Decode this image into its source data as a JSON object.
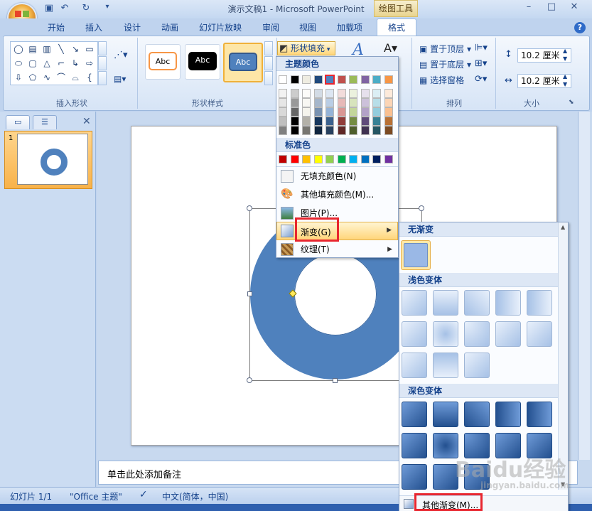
{
  "window": {
    "title": "演示文稿1 - Microsoft PowerPoint",
    "contextual_tab_group": "绘图工具"
  },
  "tabs": [
    "开始",
    "插入",
    "设计",
    "动画",
    "幻灯片放映",
    "审阅",
    "视图",
    "加载项",
    "格式"
  ],
  "ribbon": {
    "groups": {
      "insert_shapes": "插入形状",
      "shape_styles": "形状样式",
      "arrange": "排列",
      "size": "大小"
    },
    "style_sample_text": "Abc",
    "shape_fill_label": "形状填充",
    "arrange_items": [
      "置于顶层",
      "置于底层",
      "选择窗格"
    ],
    "height_value": "10.2 厘米",
    "width_value": "10.2 厘米"
  },
  "slide_panel": {
    "slide_number": "1"
  },
  "notes_placeholder": "单击此处添加备注",
  "status_bar": {
    "slide": "幻灯片 1/1",
    "theme": "\"Office 主题\"",
    "language": "中文(简体，中国)"
  },
  "fill_menu": {
    "theme_colors_header": "主题颜色",
    "standard_colors_header": "标准色",
    "theme_colors_top": [
      "#ffffff",
      "#000000",
      "#eeece1",
      "#1f497d",
      "#4f81bd",
      "#c0504d",
      "#9bbb59",
      "#8064a2",
      "#4bacc6",
      "#f79646"
    ],
    "standard_colors": [
      "#c00000",
      "#ff0000",
      "#ffc000",
      "#ffff00",
      "#92d050",
      "#00b050",
      "#00b0f0",
      "#0070c0",
      "#002060",
      "#7030a0"
    ],
    "items": {
      "no_fill": "无填充颜色(N)",
      "more_colors": "其他填充颜色(M)...",
      "picture": "图片(P)...",
      "gradient": "渐变(G)",
      "texture": "纹理(T)"
    }
  },
  "gradient_menu": {
    "no_gradient_header": "无渐变",
    "light_variations_header": "浅色变体",
    "dark_variations_header": "深色变体",
    "more_gradients": "其他渐变(M)..."
  },
  "watermark": {
    "brand": "Baidu经验",
    "url": "jingyan.baidu.com"
  },
  "colors": {
    "accent": "#4f81bd",
    "highlight_box": "#e8262f"
  }
}
